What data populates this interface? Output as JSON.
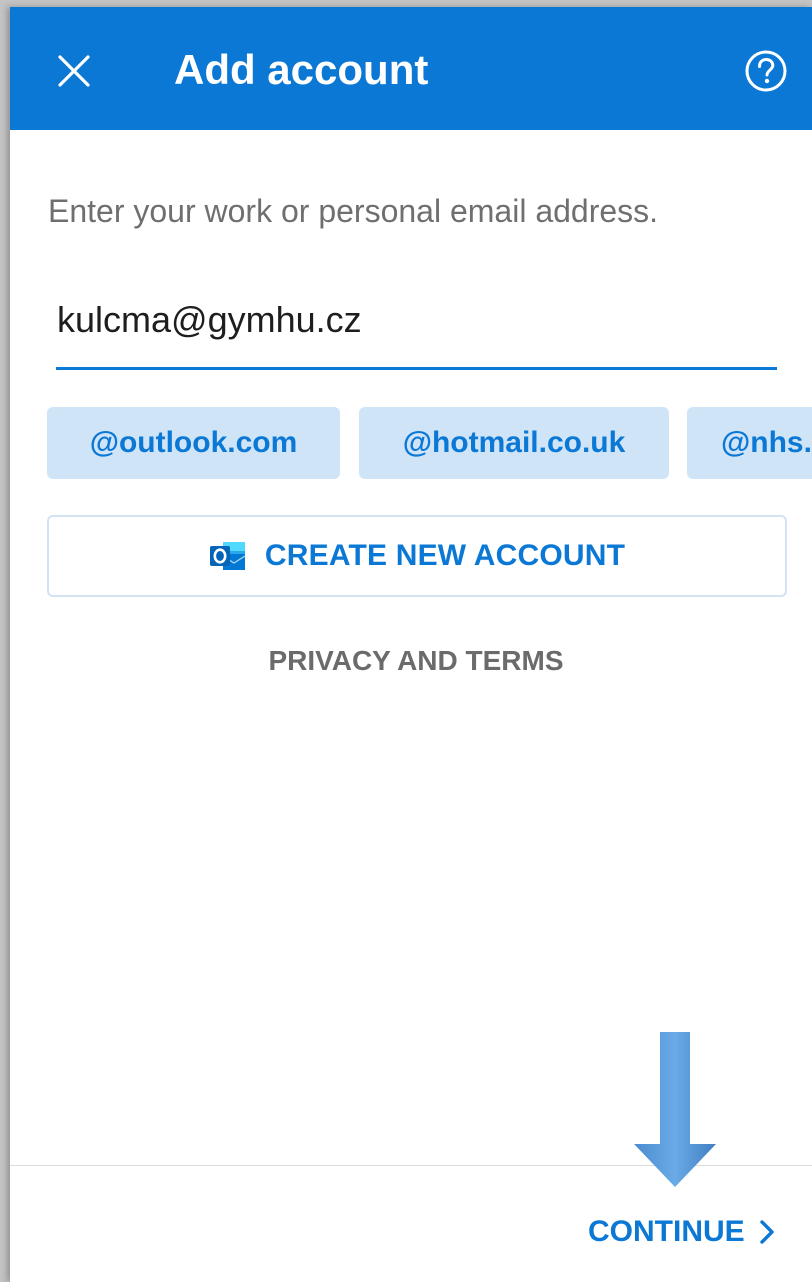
{
  "header": {
    "title": "Add account",
    "close_icon": "close-icon",
    "help_icon": "help-circle-icon",
    "background_color": "#0a78d4"
  },
  "form": {
    "prompt": "Enter your work or personal email address.",
    "email_value": "kulcma@gymhu.cz",
    "accent_color": "#0a78d4"
  },
  "suggestions": [
    {
      "label": "@outlook.com"
    },
    {
      "label": "@hotmail.co.uk"
    },
    {
      "label": "@nhs."
    }
  ],
  "create_account": {
    "label": "CREATE NEW ACCOUNT",
    "icon": "outlook-logo-icon"
  },
  "privacy_link": "PRIVACY AND TERMS",
  "footer": {
    "continue_label": "CONTINUE",
    "continue_icon": "chevron-right-icon"
  },
  "annotation": {
    "icon": "down-arrow-pointer-icon",
    "color": "#5a9bd8"
  }
}
